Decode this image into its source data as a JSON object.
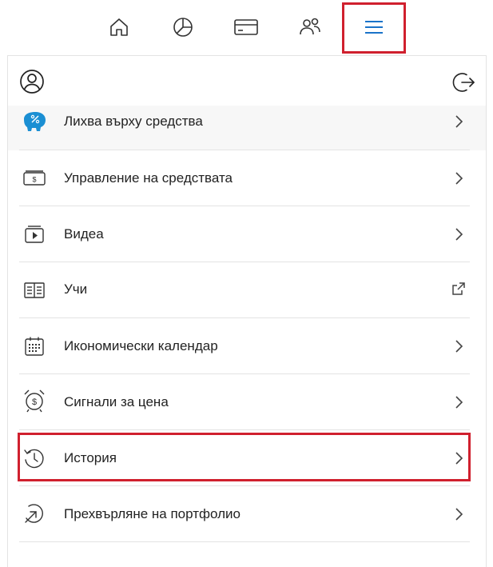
{
  "nav": {
    "items": [
      {
        "icon": "home-icon"
      },
      {
        "icon": "portfolio-pie-icon"
      },
      {
        "icon": "card-icon"
      },
      {
        "icon": "people-icon"
      },
      {
        "icon": "menu-icon",
        "active": true
      }
    ],
    "accent_color": "#1a73c9"
  },
  "menu": {
    "items": [
      {
        "label": "Лихва върху средства",
        "icon": "piggy-bank-icon",
        "trailing": "chevron-right-icon"
      },
      {
        "label": "Управление на средствата",
        "icon": "money-icon",
        "trailing": "chevron-right-icon"
      },
      {
        "label": "Видеа",
        "icon": "video-icon",
        "trailing": "chevron-right-icon"
      },
      {
        "label": "Учи",
        "icon": "book-icon",
        "trailing": "external-link-icon"
      },
      {
        "label": "Икономически календар",
        "icon": "calendar-icon",
        "trailing": "chevron-right-icon"
      },
      {
        "label": "Сигнали за цена",
        "icon": "price-alert-icon",
        "trailing": "chevron-right-icon"
      },
      {
        "label": "История",
        "icon": "history-icon",
        "trailing": "chevron-right-icon"
      },
      {
        "label": "Прехвърляне на портфолио",
        "icon": "transfer-icon",
        "trailing": "chevron-right-icon"
      }
    ]
  },
  "highlight_color": "#d0202e"
}
